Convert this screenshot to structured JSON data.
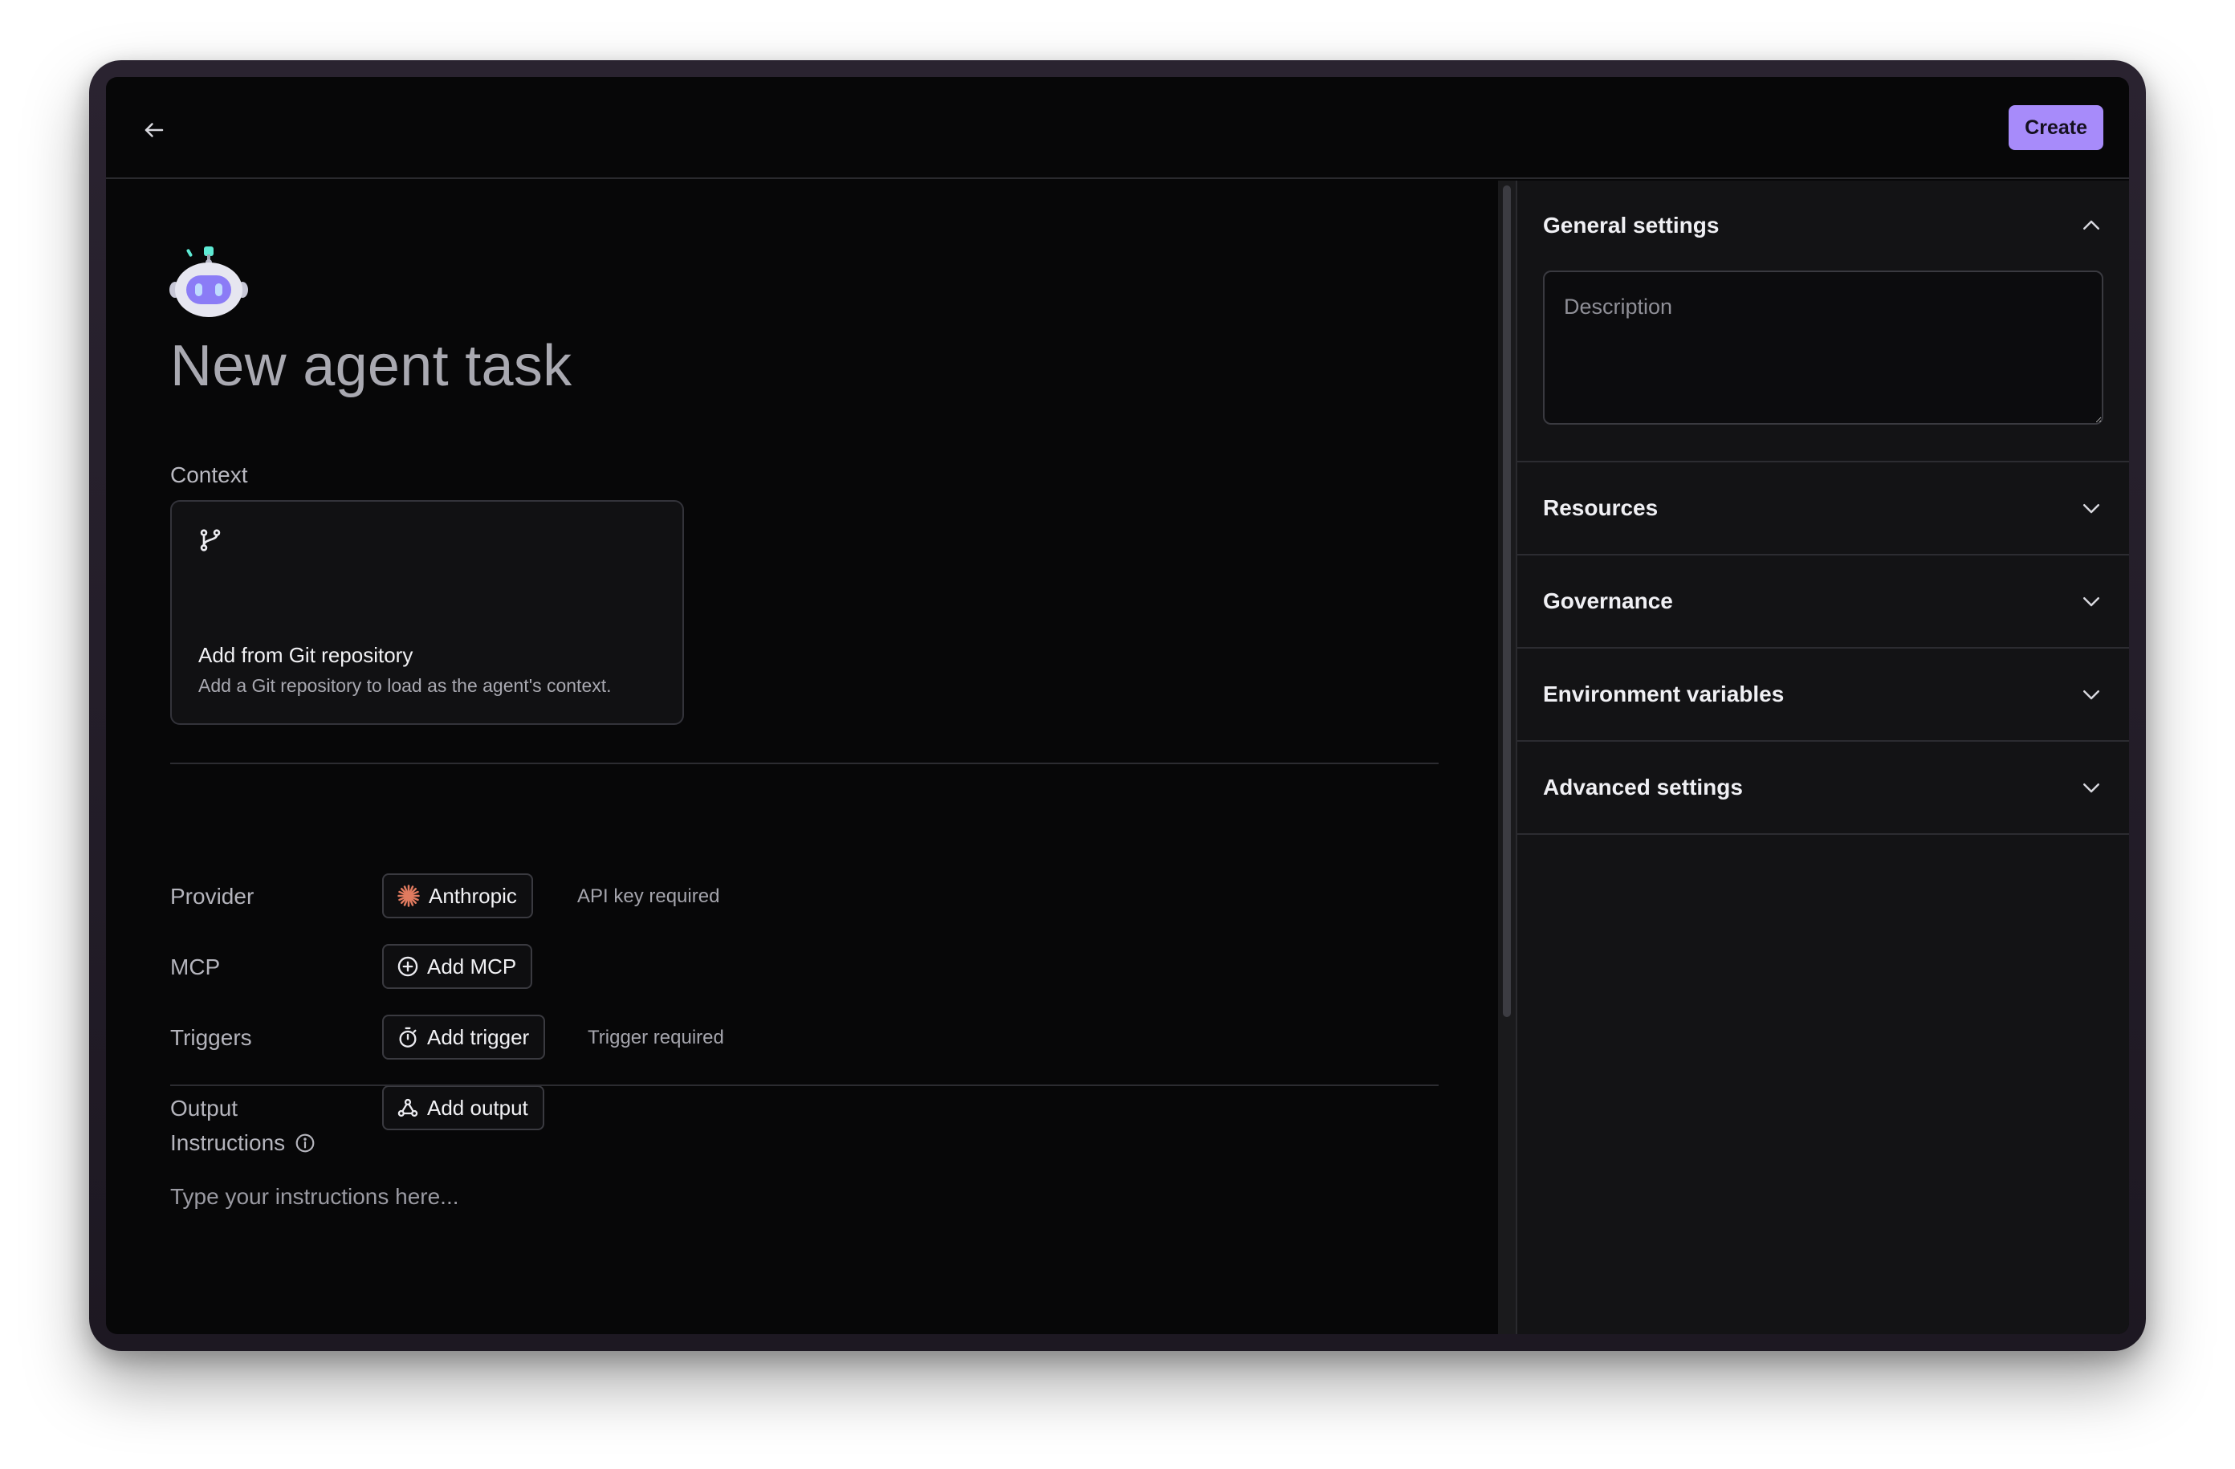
{
  "header": {
    "back_icon": "arrow-left-icon",
    "create_label": "Create",
    "accent_color": "#a78bfa"
  },
  "main": {
    "avatar_icon": "robot-icon",
    "title": "New agent task",
    "context": {
      "label": "Context",
      "card": {
        "icon": "git-branch-icon",
        "title": "Add from Git repository",
        "subtitle": "Add a Git repository to load as the agent's context."
      }
    },
    "rows": {
      "provider": {
        "label": "Provider",
        "value": "Anthropic",
        "icon": "anthropic-icon",
        "hint": "API key required"
      },
      "mcp": {
        "label": "MCP",
        "button": "Add MCP",
        "icon": "plus-circle-icon"
      },
      "triggers": {
        "label": "Triggers",
        "button": "Add trigger",
        "icon": "stopwatch-icon",
        "hint": "Trigger required"
      },
      "output": {
        "label": "Output",
        "button": "Add output",
        "icon": "webhook-icon"
      }
    },
    "instructions": {
      "label": "Instructions",
      "info_icon": "info-icon",
      "placeholder": "Type your instructions here..."
    }
  },
  "settings": {
    "general": {
      "title": "General settings",
      "expanded": true,
      "description_placeholder": "Description"
    },
    "sections": [
      {
        "title": "Resources",
        "expanded": false
      },
      {
        "title": "Governance",
        "expanded": false
      },
      {
        "title": "Environment variables",
        "expanded": false
      },
      {
        "title": "Advanced settings",
        "expanded": false
      }
    ]
  }
}
